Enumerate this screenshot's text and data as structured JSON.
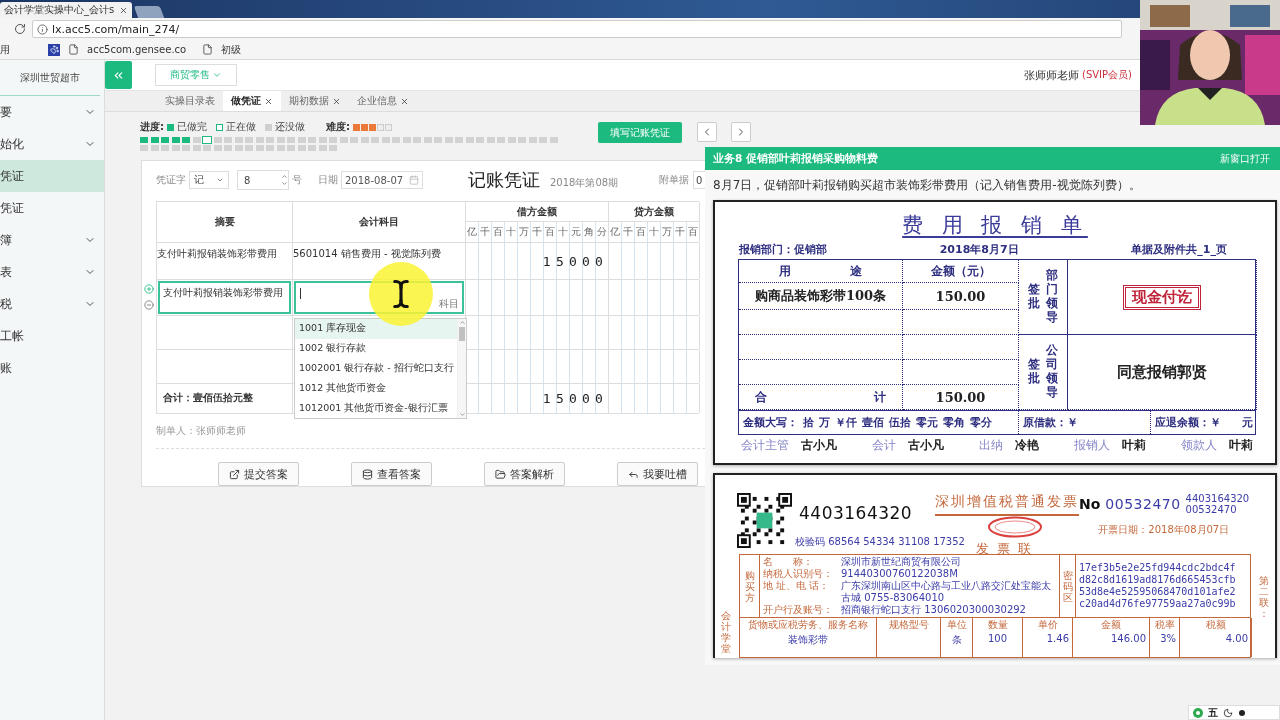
{
  "browser": {
    "tab_title": "会计学堂实操中心_会计s",
    "url": "lx.acc5.com/main_274/",
    "bookmarks": [
      {
        "kind": "plain",
        "label": "用"
      },
      {
        "kind": "page",
        "label": "acc5com.gensee.co"
      },
      {
        "kind": "page",
        "label": "初级"
      }
    ]
  },
  "sidebar": {
    "company": "深圳世贸超市",
    "items": [
      {
        "label": "要",
        "expandable": true,
        "selected": false
      },
      {
        "label": "始化",
        "expandable": true,
        "selected": false
      },
      {
        "label": "凭证",
        "expandable": false,
        "selected": true
      },
      {
        "label": "凭证",
        "expandable": false,
        "selected": false
      },
      {
        "label": "簿",
        "expandable": true,
        "selected": false
      },
      {
        "label": "表",
        "expandable": true,
        "selected": false
      },
      {
        "label": "税",
        "expandable": true,
        "selected": false
      },
      {
        "label": "工帐",
        "expandable": false,
        "selected": false
      },
      {
        "label": "账",
        "expandable": false,
        "selected": false
      }
    ]
  },
  "topbar": {
    "industry": "商贸零售",
    "user": "张师师老师",
    "membership": "(SVIP会员)"
  },
  "tabs": [
    {
      "label": "实操目录表",
      "closable": false,
      "selected": false
    },
    {
      "label": "做凭证",
      "closable": true,
      "selected": true
    },
    {
      "label": "期初数据",
      "closable": true,
      "selected": false
    },
    {
      "label": "企业信息",
      "closable": true,
      "selected": false
    }
  ],
  "progress": {
    "label": "进度:",
    "legend": [
      {
        "kind": "done",
        "label": "已做完"
      },
      {
        "kind": "current",
        "label": "正在做"
      },
      {
        "kind": "todo",
        "label": "还没做"
      }
    ],
    "difficulty_label": "难度:",
    "stars": 3,
    "cells": [
      {
        "kind": "done"
      },
      {
        "kind": "done"
      },
      {
        "kind": "done"
      },
      {
        "kind": "done"
      },
      {
        "kind": "done"
      },
      {
        "kind": "todo"
      },
      {
        "kind": "current"
      },
      {
        "kind": "todo"
      },
      {
        "kind": "todo"
      },
      {
        "kind": "todo"
      },
      {
        "kind": "todo"
      },
      {
        "kind": "todo"
      },
      {
        "kind": "todo"
      },
      {
        "kind": "todo"
      },
      {
        "kind": "todo"
      },
      {
        "kind": "todo"
      },
      {
        "kind": "todo"
      },
      {
        "kind": "todo"
      },
      {
        "kind": "todo"
      },
      {
        "kind": "todo"
      },
      {
        "kind": "todo"
      },
      {
        "kind": "todo"
      },
      {
        "kind": "todo"
      },
      {
        "kind": "todo"
      },
      {
        "kind": "todo"
      },
      {
        "kind": "todo"
      },
      {
        "kind": "todo"
      },
      {
        "kind": "todo"
      },
      {
        "kind": "todo"
      },
      {
        "kind": "todo"
      },
      {
        "kind": "todo"
      },
      {
        "kind": "todo"
      },
      {
        "kind": "todo"
      },
      {
        "kind": "todo"
      },
      {
        "kind": "todo"
      },
      {
        "kind": "todo"
      },
      {
        "kind": "todo"
      },
      {
        "kind": "todo"
      },
      {
        "kind": "todo"
      },
      {
        "kind": "todo"
      },
      {
        "kind": "todo"
      },
      {
        "kind": "todo"
      },
      {
        "kind": "todo"
      },
      {
        "kind": "todo"
      },
      {
        "kind": "todo"
      },
      {
        "kind": "todo"
      },
      {
        "kind": "todo"
      },
      {
        "kind": "todo"
      },
      {
        "kind": "todo"
      },
      {
        "kind": "todo"
      },
      {
        "kind": "todo"
      },
      {
        "kind": "todo"
      },
      {
        "kind": "todo"
      },
      {
        "kind": "todo"
      },
      {
        "kind": "todo"
      },
      {
        "kind": "todo"
      },
      {
        "kind": "todo"
      },
      {
        "kind": "todo"
      },
      {
        "kind": "todo"
      }
    ]
  },
  "fill_button": "填写记账凭证",
  "voucher": {
    "word_label": "凭证字",
    "word": "记",
    "number": "8",
    "number_suffix": "号",
    "date_label": "日期",
    "date": "2018-08-07",
    "title": "记账凭证",
    "period": "2018年第08期",
    "attachments_label": "附单据",
    "attachments": "0",
    "summary_header": "摘要",
    "subject_header": "会计科目",
    "debit_header": "借方金额",
    "credit_header": "贷方金额",
    "debit_digits": [
      "亿",
      "千",
      "百",
      "十",
      "万",
      "千",
      "百",
      "十",
      "元",
      "角",
      "分"
    ],
    "credit_digits": [
      "亿",
      "千",
      "百",
      "十",
      "万",
      "千",
      "百"
    ],
    "rows": [
      {
        "kind": "entry",
        "summary": "支付叶莉报销装饰彩带费用",
        "subject": "5601014 销售费用 - 视觉陈列费",
        "debit": "15000"
      },
      {
        "kind": "editing",
        "summary": "支付叶莉报销装饰彩带费用",
        "subject_hint": "科目"
      },
      {
        "kind": "empty"
      },
      {
        "kind": "empty"
      },
      {
        "kind": "total",
        "summary": "合计：壹佰伍拾元整",
        "debit": "15000"
      }
    ],
    "suggestions": [
      {
        "text": "1001 库存现金",
        "selected": true
      },
      {
        "text": "1002 银行存款",
        "selected": false
      },
      {
        "text": "1002001 银行存款 - 招行蛇口支行",
        "selected": false
      },
      {
        "text": "1012 其他货币资金",
        "selected": false
      },
      {
        "text": "1012001 其他货币资金-银行汇票",
        "selected": false
      }
    ],
    "maker": "制单人：张师师老师",
    "actions": [
      {
        "kind": "submit",
        "label": "提交答案"
      },
      {
        "kind": "view",
        "label": "查看答案"
      },
      {
        "kind": "explain",
        "label": "答案解析"
      },
      {
        "kind": "feedback",
        "label": "我要吐槽"
      }
    ]
  },
  "task": {
    "title": "业务8 促销部叶莉报销采购物料费",
    "open_new": "新窗口打开",
    "description": "8月7日，促销部叶莉报销购买超市装饰彩带费用（记入销售费用-视觉陈列费）。"
  },
  "expense_form": {
    "title": "费 用 报 销 单",
    "department": "报销部门：促销部",
    "date": "2018年8月7日",
    "attachments": "单据及附件共_1_页",
    "purpose_header": "用途",
    "amount_header": "金额（元）",
    "lines": [
      {
        "purpose": "购商品装饰彩带100条",
        "amount": "150.00"
      }
    ],
    "total_label": "合计",
    "total": "150.00",
    "dept_sign": "签批",
    "dept_role": "部门领导",
    "stamp": "现金付讫",
    "company_sign": "签批",
    "company_role": "公司领导",
    "company_note": "同意报销郭贤",
    "words_label": "金额大写：",
    "words": [
      "拾",
      "万",
      "￥仟",
      "壹佰",
      "伍拾",
      "零元",
      "零角",
      "零分"
    ],
    "advance": "原借款：￥",
    "refund": "应退余额：￥",
    "refund_unit": "元",
    "signatures": [
      {
        "role": "会计主管",
        "name": "古小凡"
      },
      {
        "role": "会计",
        "name": "古小凡"
      },
      {
        "role": "出纳",
        "name": "冷艳"
      },
      {
        "role": "报销人",
        "name": "叶莉"
      },
      {
        "role": "领款人",
        "name": "叶莉"
      }
    ]
  },
  "invoice": {
    "code": "4403164320",
    "title": "深圳增值税普通发票",
    "copy": "发票联",
    "no_label": "No",
    "number": "00532470",
    "code_small": "4403164320",
    "number_small": "00532470",
    "check_code": "校验码 68564 54334 31108 17352",
    "date": "开票日期：2018年08月07日",
    "buyer_label": "购买方",
    "buyer": [
      {
        "label": "名　　称：",
        "value": "深圳市新世纪商贸有限公司"
      },
      {
        "label": "纳税人识别号：",
        "value": "91440300760122038M"
      },
      {
        "label": "地 址、电 话：",
        "value": "广东深圳南山区中心路与工业八路交汇处宝能太古城 0755-83064010"
      },
      {
        "label": "开户行及账号：",
        "value": "招商银行蛇口支行 1306020300030292"
      }
    ],
    "cipher_label": "密码区",
    "cipher": [
      "17ef3b5e2e25fd944cdc2bdc4f",
      "d82c8d1619ad8176d665453cfb",
      "53d8e4e52595068470d101afe2",
      "c20ad4d76fe97759aa27a0c99b"
    ],
    "items_header": [
      "货物或应税劳务、服务名称",
      "规格型号",
      "单位",
      "数量",
      "单价",
      "金额",
      "税率",
      "税额"
    ],
    "items": [
      {
        "name": "装饰彩带",
        "unit": "条",
        "qty": "100",
        "price": "1.46",
        "amount": "146.00",
        "rate": "3%",
        "tax": "4.00"
      }
    ],
    "left_margin": "会计学堂",
    "right_margin": "第二联："
  },
  "ime": {
    "label": "五"
  }
}
